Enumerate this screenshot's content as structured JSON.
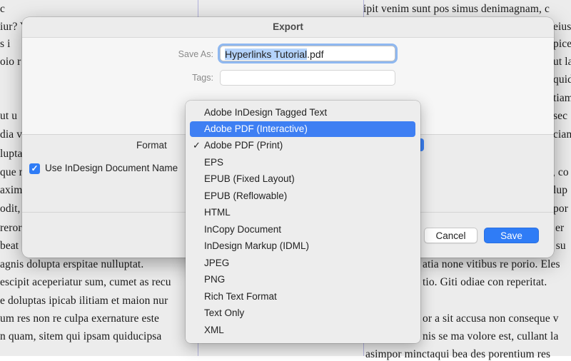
{
  "document": {
    "left_fragments": [
      "c",
      "iur? Y",
      "s i",
      "oio r",
      "",
      " ut u",
      "dia v",
      "luptac",
      "que n",
      "axim",
      "odit,",
      "rerore",
      "beat",
      "agnis dolupta erspitae nulluptat.",
      "escipit aceperiatur sum, cumet as recu",
      "e doluptas ipicab ilitiam et maion nur",
      "um res non re culpa exernature este",
      "n quam, sitem qui ipsam quiducipsa"
    ],
    "right_fragments": [
      "ipit venim sunt pos simus denimagnam, c",
      "eius u",
      "picen",
      "ut la",
      "quid",
      "tiam",
      "sec",
      "ciam",
      "ae, co",
      "lup",
      "por",
      "er",
      "ne su",
      "atia none vitibus re porio. Eles",
      "tio. Giti odiae con reperitat.",
      "",
      "or a sit accusa non conseque v",
      "nis se ma volore est, cullant la",
      "asimpor minctaqui bea des porentium res"
    ]
  },
  "dialog": {
    "title": "Export",
    "save_as_label": "Save As:",
    "filename_selected": "Hyperlinks Tutorial",
    "filename_ext": ".pdf",
    "tags_label": "Tags:",
    "format_label": "Format",
    "checkbox_label": "Use InDesign Document Name",
    "checkbox_checked": true,
    "cancel_label": "Cancel",
    "save_label": "Save"
  },
  "format_menu": {
    "selected": "Adobe PDF (Print)",
    "highlighted": "Adobe PDF (Interactive)",
    "items": [
      "Adobe InDesign Tagged Text",
      "Adobe PDF (Interactive)",
      "Adobe PDF (Print)",
      "EPS",
      "EPUB (Fixed Layout)",
      "EPUB (Reflowable)",
      "HTML",
      "InCopy Document",
      "InDesign Markup (IDML)",
      "JPEG",
      "PNG",
      "Rich Text Format",
      "Text Only",
      "XML"
    ],
    "check_glyph": "✓"
  },
  "colors": {
    "accent": "#2f7cf6",
    "highlight": "#3e7ff3"
  }
}
